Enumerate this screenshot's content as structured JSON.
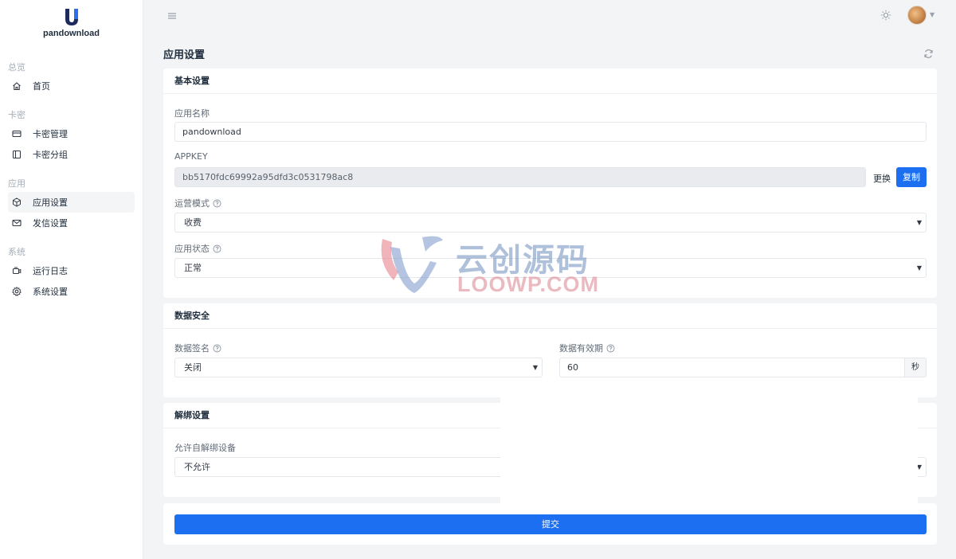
{
  "brand": {
    "name": "pandownload"
  },
  "sidebar": {
    "groups": [
      {
        "title": "总览",
        "items": [
          {
            "label": "首页",
            "icon": "home-icon"
          }
        ]
      },
      {
        "title": "卡密",
        "items": [
          {
            "label": "卡密管理",
            "icon": "card-icon"
          },
          {
            "label": "卡密分组",
            "icon": "panel-icon"
          }
        ]
      },
      {
        "title": "应用",
        "items": [
          {
            "label": "应用设置",
            "icon": "cube-icon",
            "active": true
          },
          {
            "label": "发信设置",
            "icon": "mail-icon"
          }
        ]
      },
      {
        "title": "系统",
        "items": [
          {
            "label": "运行日志",
            "icon": "log-icon"
          },
          {
            "label": "系统设置",
            "icon": "gear-icon"
          }
        ]
      }
    ]
  },
  "page": {
    "title": "应用设置"
  },
  "basic": {
    "title": "基本设置",
    "app_name_label": "应用名称",
    "app_name_value": "pandownload",
    "appkey_label": "APPKEY",
    "appkey_value": "bb5170fdc69992a95dfd3c0531798ac8",
    "replace_label": "更换",
    "copy_label": "复制",
    "mode_label": "运营模式",
    "mode_value": "收费",
    "status_label": "应用状态",
    "status_value": "正常"
  },
  "security": {
    "title": "数据安全",
    "sign_label": "数据签名",
    "sign_value": "关闭",
    "validity_label": "数据有效期",
    "validity_value": "60",
    "validity_unit": "秒"
  },
  "unbind": {
    "title": "解绑设置",
    "self_unbind_label": "允许自解绑设备",
    "self_unbind_value": "不允许"
  },
  "submit_label": "提交",
  "watermark": {
    "cn": "云创源码",
    "en": "LOOWP.COM"
  },
  "colors": {
    "primary": "#1d6ff2",
    "background": "#f3f4f6"
  }
}
